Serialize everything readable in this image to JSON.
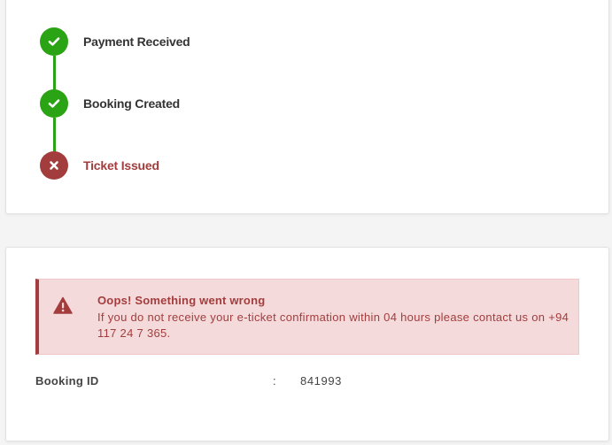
{
  "colors": {
    "success": "#2aa315",
    "error": "#a33d3d",
    "alert_bg": "#f5dadb",
    "text": "#333333"
  },
  "status_steps": [
    {
      "label": "Payment Received",
      "state": "done",
      "icon": "check-icon"
    },
    {
      "label": "Booking Created",
      "state": "done",
      "icon": "check-icon"
    },
    {
      "label": "Ticket Issued",
      "state": "failed",
      "icon": "x-icon"
    }
  ],
  "alert": {
    "icon": "warning-triangle-icon",
    "title": "Oops! Something went wrong",
    "message": "If you do not receive your e-ticket confirmation within 04 hours please contact us on +94 117 24 7 365."
  },
  "booking": {
    "label": "Booking ID",
    "separator": ":",
    "value": "841993"
  }
}
